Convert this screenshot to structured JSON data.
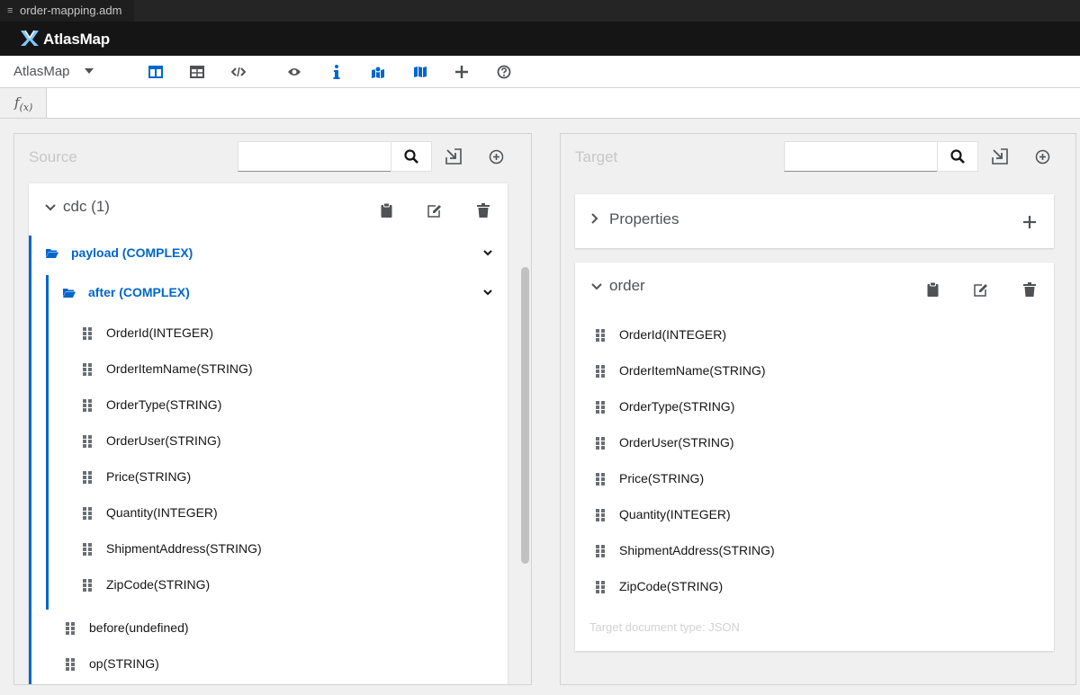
{
  "window": {
    "tab_title": "order-mapping.adm",
    "tab_icon": "menu-lines-icon"
  },
  "brand": {
    "name": "AtlasMap"
  },
  "toolbar": {
    "app_menu_label": "AtlasMap",
    "buttons": [
      {
        "name": "column-mapping-view-button",
        "icon": "columns-icon",
        "active": true
      },
      {
        "name": "mapping-table-view-button",
        "icon": "table-icon"
      },
      {
        "name": "namespace-view-button",
        "icon": "code-icon"
      },
      {
        "name": "toggle-preview-button",
        "icon": "eye-icon"
      },
      {
        "name": "show-types-button",
        "icon": "info-icon",
        "active": true
      },
      {
        "name": "show-mapped-fields-button",
        "icon": "map-marker-icon",
        "active": true
      },
      {
        "name": "show-unmapped-fields-button",
        "icon": "map-icon",
        "active": true
      },
      {
        "name": "create-mapping-button",
        "icon": "plus-icon"
      },
      {
        "name": "help-button",
        "icon": "question-circle-icon"
      }
    ]
  },
  "expression": {
    "label_main": "f",
    "label_sub": "(x)"
  },
  "source": {
    "title": "Source",
    "search_value": "",
    "document": {
      "title": "cdc (1)",
      "payload_label": "payload (COMPLEX)",
      "after_label": "after (COMPLEX)",
      "after_fields": [
        "OrderId(INTEGER)",
        "OrderItemName(STRING)",
        "OrderType(STRING)",
        "OrderUser(STRING)",
        "Price(STRING)",
        "Quantity(INTEGER)",
        "ShipmentAddress(STRING)",
        "ZipCode(STRING)"
      ],
      "payload_fields": [
        "before(undefined)",
        "op(STRING)"
      ]
    }
  },
  "target": {
    "title": "Target",
    "search_value": "",
    "properties_title": "Properties",
    "document": {
      "title": "order",
      "fields": [
        "OrderId(INTEGER)",
        "OrderItemName(STRING)",
        "OrderType(STRING)",
        "OrderUser(STRING)",
        "Price(STRING)",
        "Quantity(INTEGER)",
        "ShipmentAddress(STRING)",
        "ZipCode(STRING)"
      ],
      "doc_type": "Target document type: JSON"
    }
  },
  "colors": {
    "accent": "#0066cc",
    "masthead": "#151515",
    "icon_gray": "#4f5255"
  }
}
